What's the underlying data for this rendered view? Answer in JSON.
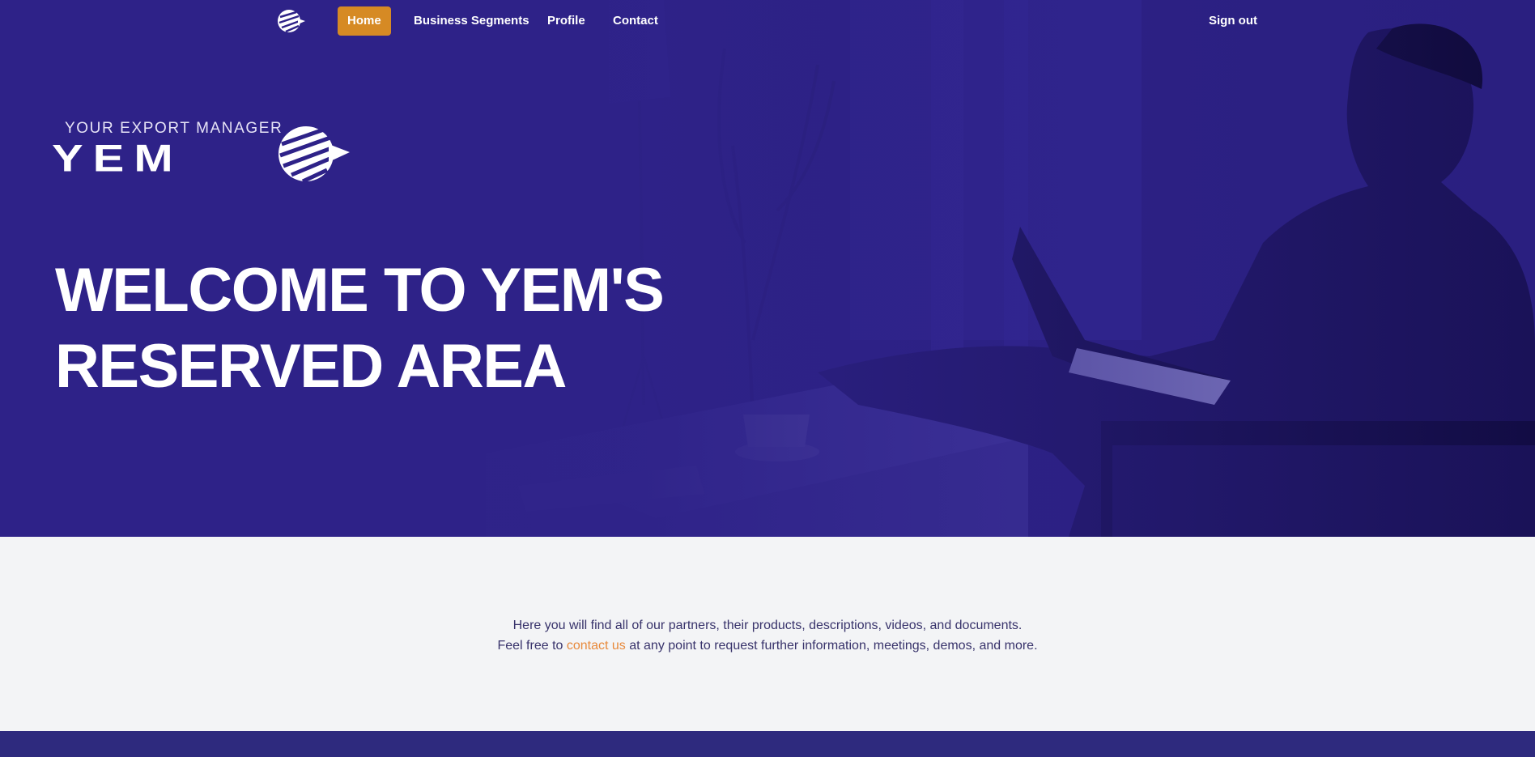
{
  "colors": {
    "hero_bg": "#2e2288",
    "accent": "#d68a24",
    "link": "#e88a3c",
    "body_bg": "#f3f4f6",
    "text": "#38336b",
    "footer": "#2e2a7e"
  },
  "nav": {
    "logo_icon": "globe-arrow-logo",
    "items": [
      {
        "label": "Home",
        "active": true
      },
      {
        "label": "Business Segments",
        "active": false
      },
      {
        "label": "Profile",
        "active": false
      },
      {
        "label": "Contact",
        "active": false
      }
    ],
    "signout_label": "Sign out"
  },
  "brand": {
    "tagline": "YOUR EXPORT MANAGER",
    "wordmark": "YEM"
  },
  "hero": {
    "headline_line1": "WELCOME TO YEM'S",
    "headline_line2": "RESERVED AREA",
    "image": "man-with-laptop-photo"
  },
  "intro": {
    "line1": "Here you will find all of our partners, their products, descriptions, videos, and documents.",
    "line2_prefix": "Feel free to ",
    "line2_link": "contact us",
    "line2_suffix": " at any point to request further information, meetings, demos, and more."
  }
}
